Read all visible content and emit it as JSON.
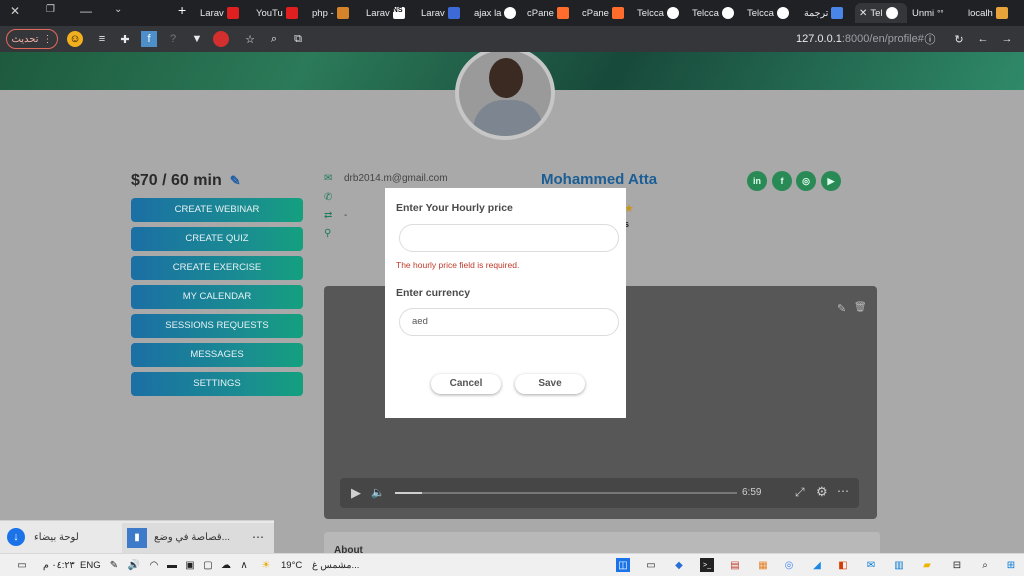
{
  "browser": {
    "tabs": [
      {
        "label": "Larav",
        "color": "#cc1f1f"
      },
      {
        "label": "YouTu",
        "color": "#e02020"
      },
      {
        "label": "php -",
        "color": "#d5842b"
      },
      {
        "label": "Larav",
        "color": "#ffffff"
      },
      {
        "label": "Larav",
        "color": "#3d6ad6"
      },
      {
        "label": "ajax la",
        "color": "#ffffff"
      },
      {
        "label": "cPane",
        "color": "#ff6c2c"
      },
      {
        "label": "cPane",
        "color": "#ff6c2c"
      },
      {
        "label": "Telcca",
        "color": "#ffffff"
      },
      {
        "label": "Telcca",
        "color": "#ffffff"
      },
      {
        "label": "Telcca",
        "color": "#ffffff"
      },
      {
        "label": "ترجمة",
        "color": "#4a86e8"
      },
      {
        "label": "Tel",
        "color": "#ffffff"
      },
      {
        "label": "Unmi",
        "color": "#ffffff"
      },
      {
        "label": "localh",
        "color": "#e8a33a"
      }
    ],
    "update_label": "تحديث",
    "url_host": "127.0.0.1",
    "url_path": ":8000/en/profile#"
  },
  "profile": {
    "price": "$70 / 60 min",
    "email": "drb2014.m@gmail.com",
    "phone_dash": "-",
    "name": "Mohammed Atta",
    "rating_sub": "s",
    "social": [
      "in",
      "f",
      "◎",
      "▶"
    ],
    "menu": [
      "CREATE WEBINAR",
      "CREATE QUIZ",
      "CREATE EXERCISE",
      "MY CALENDAR",
      "SESSIONS REQUESTS",
      "MESSAGES",
      "SETTINGS"
    ],
    "about_label": "About"
  },
  "video": {
    "duration": "6:59",
    "progress": 0.08
  },
  "modal": {
    "hourly_label": "Enter Your Hourly price",
    "hourly_value": "",
    "hourly_error": "The hourly price field is required.",
    "currency_label": "Enter currency",
    "currency_value": "aed",
    "cancel_label": "Cancel",
    "save_label": "Save"
  },
  "downloads": [
    {
      "label": "لوحة بيضاء"
    },
    {
      "label": "قصاصة في وضع..."
    }
  ],
  "taskbar": {
    "time": "٠٤:٢٣ م",
    "lang": "ENG",
    "temperature": "19°C",
    "weather": "مشمس غ..."
  }
}
